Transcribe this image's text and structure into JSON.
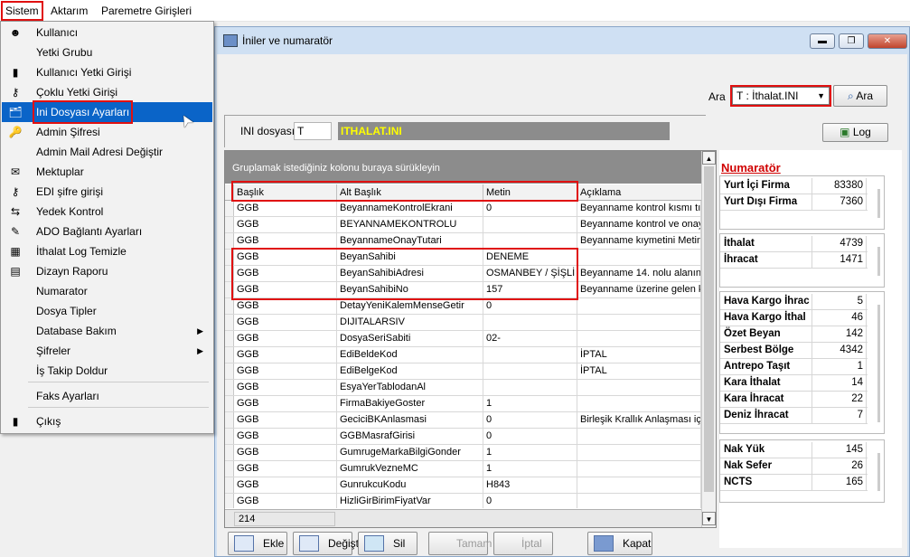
{
  "menubar": {
    "items": [
      "Sistem",
      "Aktarım",
      "Paremetre Girişleri"
    ]
  },
  "menu": {
    "items": [
      {
        "label": "Kullanıcı",
        "icon": "user-icon",
        "glyph": "☻"
      },
      {
        "label": "Yetki Grubu",
        "icon": "",
        "glyph": ""
      },
      {
        "label": "Kullanıcı Yetki Girişi",
        "icon": "user-key-icon",
        "glyph": "▮"
      },
      {
        "label": "Çoklu Yetki Girişi",
        "icon": "keys-icon",
        "glyph": "⚷"
      },
      {
        "label": "Ini Dosyası  Ayarları",
        "icon": "folder-settings-icon",
        "glyph": "🗂"
      },
      {
        "label": "Admin Şifresi",
        "icon": "key-icon",
        "glyph": "🔑"
      },
      {
        "label": "Admin Mail Adresi Değiştir",
        "icon": "",
        "glyph": ""
      },
      {
        "label": "Mektuplar",
        "icon": "letter-icon",
        "glyph": "✉"
      },
      {
        "label": "EDI şifre girişi",
        "icon": "keys-icon",
        "glyph": "⚷"
      },
      {
        "label": "Yedek Kontrol",
        "icon": "backup-icon",
        "glyph": "⇆"
      },
      {
        "label": "ADO Bağlantı Ayarları",
        "icon": "connection-icon",
        "glyph": "✎"
      },
      {
        "label": "İthalat Log Temizle",
        "icon": "log-clean-icon",
        "glyph": "▦"
      },
      {
        "label": "Dizayn Raporu",
        "icon": "report-icon",
        "glyph": "▤"
      },
      {
        "label": "Numarator",
        "icon": "",
        "glyph": ""
      },
      {
        "label": "Dosya Tipler",
        "icon": "",
        "glyph": ""
      },
      {
        "label": "Database Bakım",
        "icon": "",
        "glyph": "",
        "submenu": true
      },
      {
        "label": "Şifreler",
        "icon": "",
        "glyph": "",
        "submenu": true
      },
      {
        "label": "İş Takip Doldur",
        "icon": "",
        "glyph": ""
      },
      {
        "label": "Faks Ayarları",
        "icon": "",
        "glyph": ""
      },
      {
        "label": "Çıkış",
        "icon": "exit-icon",
        "glyph": "▮"
      }
    ]
  },
  "window": {
    "title": "İniler ve numaratör",
    "ara_label": "Ara",
    "combo_value": "T : İthalat.INI",
    "ara_button": "Ara",
    "log_button": "Log",
    "ini_label": "INI dosyası",
    "ini_code": "T",
    "ini_file": "ITHALAT.INI"
  },
  "grid": {
    "group_panel": "Gruplamak istediğiniz kolonu buraya sürükleyin",
    "columns": [
      "Başlık",
      "Alt Başlık",
      "Metin",
      "Açıklama"
    ],
    "rows": [
      [
        "GGB",
        "BeyannameKontrolEkrani",
        "0",
        "Beyanname kontrol kısmı tıkl"
      ],
      [
        "GGB",
        "BEYANNAMEKONTROLU",
        "",
        "Beyanname kontrol ve onay"
      ],
      [
        "GGB",
        "BeyannameOnayTutari",
        "",
        "Beyanname kıymetini Metin k"
      ],
      [
        "GGB",
        "BeyanSahibi",
        "DENEME",
        ""
      ],
      [
        "GGB",
        "BeyanSahibiAdresi",
        "OSMANBEY / ŞİŞLİ -",
        "Beyanname 14. nolu alanını"
      ],
      [
        "GGB",
        "BeyanSahibiNo",
        "157",
        "Beyanname üzerine gelen k"
      ],
      [
        "GGB",
        "DetayYeniKalemMenseGetir",
        "0",
        ""
      ],
      [
        "GGB",
        "DIJITALARSIV",
        "",
        ""
      ],
      [
        "GGB",
        "DosyaSeriSabiti",
        "02-",
        ""
      ],
      [
        "GGB",
        "EdiBeldeKod",
        "",
        "İPTAL"
      ],
      [
        "GGB",
        "EdiBelgeKod",
        "",
        "İPTAL"
      ],
      [
        "GGB",
        "EsyaYerTablodanAl",
        "",
        ""
      ],
      [
        "GGB",
        "FirmaBakiyeGoster",
        "1",
        ""
      ],
      [
        "GGB",
        "GeciciBKAnlasmasi",
        "0",
        "Birleşik Krallık Anlaşması için"
      ],
      [
        "GGB",
        "GGBMasrafGirisi",
        "0",
        ""
      ],
      [
        "GGB",
        "GumrugeMarkaBilgiGonder",
        "1",
        ""
      ],
      [
        "GGB",
        "GumrukVezneMC",
        "1",
        ""
      ],
      [
        "GGB",
        "GunrukcuKodu",
        "H843",
        ""
      ],
      [
        "GGB",
        "HizliGirBirimFiyatVar",
        "0",
        ""
      ]
    ],
    "record_count": "214"
  },
  "numarator": {
    "title": "Numaratör",
    "groups": [
      [
        [
          "Yurt İçi Firma",
          "83380"
        ],
        [
          "Yurt Dışı Firma",
          "7360"
        ]
      ],
      [
        [
          "İthalat",
          "4739"
        ],
        [
          "İhracat",
          "1471"
        ]
      ],
      [
        [
          "Hava Kargo İhrac",
          "5"
        ],
        [
          "Hava Kargo İthal",
          "46"
        ],
        [
          "Özet Beyan",
          "142"
        ],
        [
          "Serbest Bölge",
          "4342"
        ],
        [
          "Antrepo Taşıt",
          "1"
        ],
        [
          "Kara İthalat",
          "14"
        ],
        [
          "Kara İhracat",
          "22"
        ],
        [
          "Deniz İhracat",
          "7"
        ]
      ],
      [
        [
          "Nak Yük",
          "145"
        ],
        [
          "Nak Sefer",
          "26"
        ],
        [
          "NCTS",
          "165"
        ]
      ]
    ]
  },
  "buttons": [
    "Ekle",
    "Değiştir",
    "Sil",
    "Tamam",
    "İptal",
    "Kapat"
  ],
  "colors": {
    "accent": "#0a64c8",
    "highlight": "#e01010",
    "group_panel": "#8c8c8c",
    "ini_file_text": "#ffff00"
  }
}
